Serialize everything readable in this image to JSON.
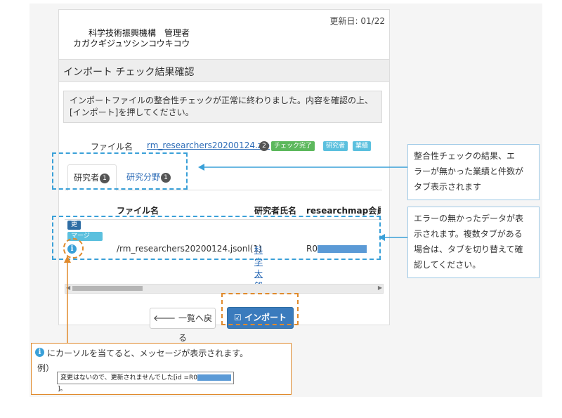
{
  "header": {
    "updated": "更新日: 01/22",
    "org_name": "科学技術振興機構　管理者",
    "org_kana": "カガクギジュツシンコウキコウ"
  },
  "title": "インポート チェック結果確認",
  "message": {
    "line1": "インポートファイルの整合性チェックが正常に終わりました。内容を確認の上、",
    "line2": "[インポート]を押してください。"
  },
  "file": {
    "label": "ファイル名",
    "name": "rm_researchers20200124.zip",
    "count": "2",
    "badges": [
      "チェック完了",
      "研究者",
      "業績"
    ]
  },
  "tabs": [
    {
      "label": "研究者",
      "count": "1"
    },
    {
      "label": "研究分野",
      "count": "1"
    }
  ],
  "table": {
    "headers": [
      "ファイル名",
      "研究者氏名",
      "researchmap会員ID"
    ],
    "row": {
      "tags": [
        "更新",
        "マージ"
      ],
      "file": "/rm_researchers20200124.jsonl(1)",
      "researcher": "科学 太郎",
      "id_prefix": "R0"
    }
  },
  "buttons": {
    "back": "一覧へ戻る",
    "import": "インポート"
  },
  "callouts": {
    "tabs": [
      "整合性チェックの結果、エ",
      "ラーが無かった業績と件数が",
      "タブ表示されます"
    ],
    "data": [
      "エラーの無かったデータが表",
      "示されます。複数タブがある",
      "場合は、タブを切り替えて確",
      "認してください。"
    ]
  },
  "note": {
    "text": "にカーソルを当てると、メッセージが表示されます。",
    "example_label": "例）",
    "example": "変更はないので、更新されませんでした[id =R0",
    "example_end": "]。"
  },
  "colors": {
    "accent": "#3a7bbd",
    "callout_border": "#3aa0d8",
    "highlight": "#e08a2c",
    "badge_green": "#5cb85c",
    "badge_blue": "#5bc0de"
  }
}
